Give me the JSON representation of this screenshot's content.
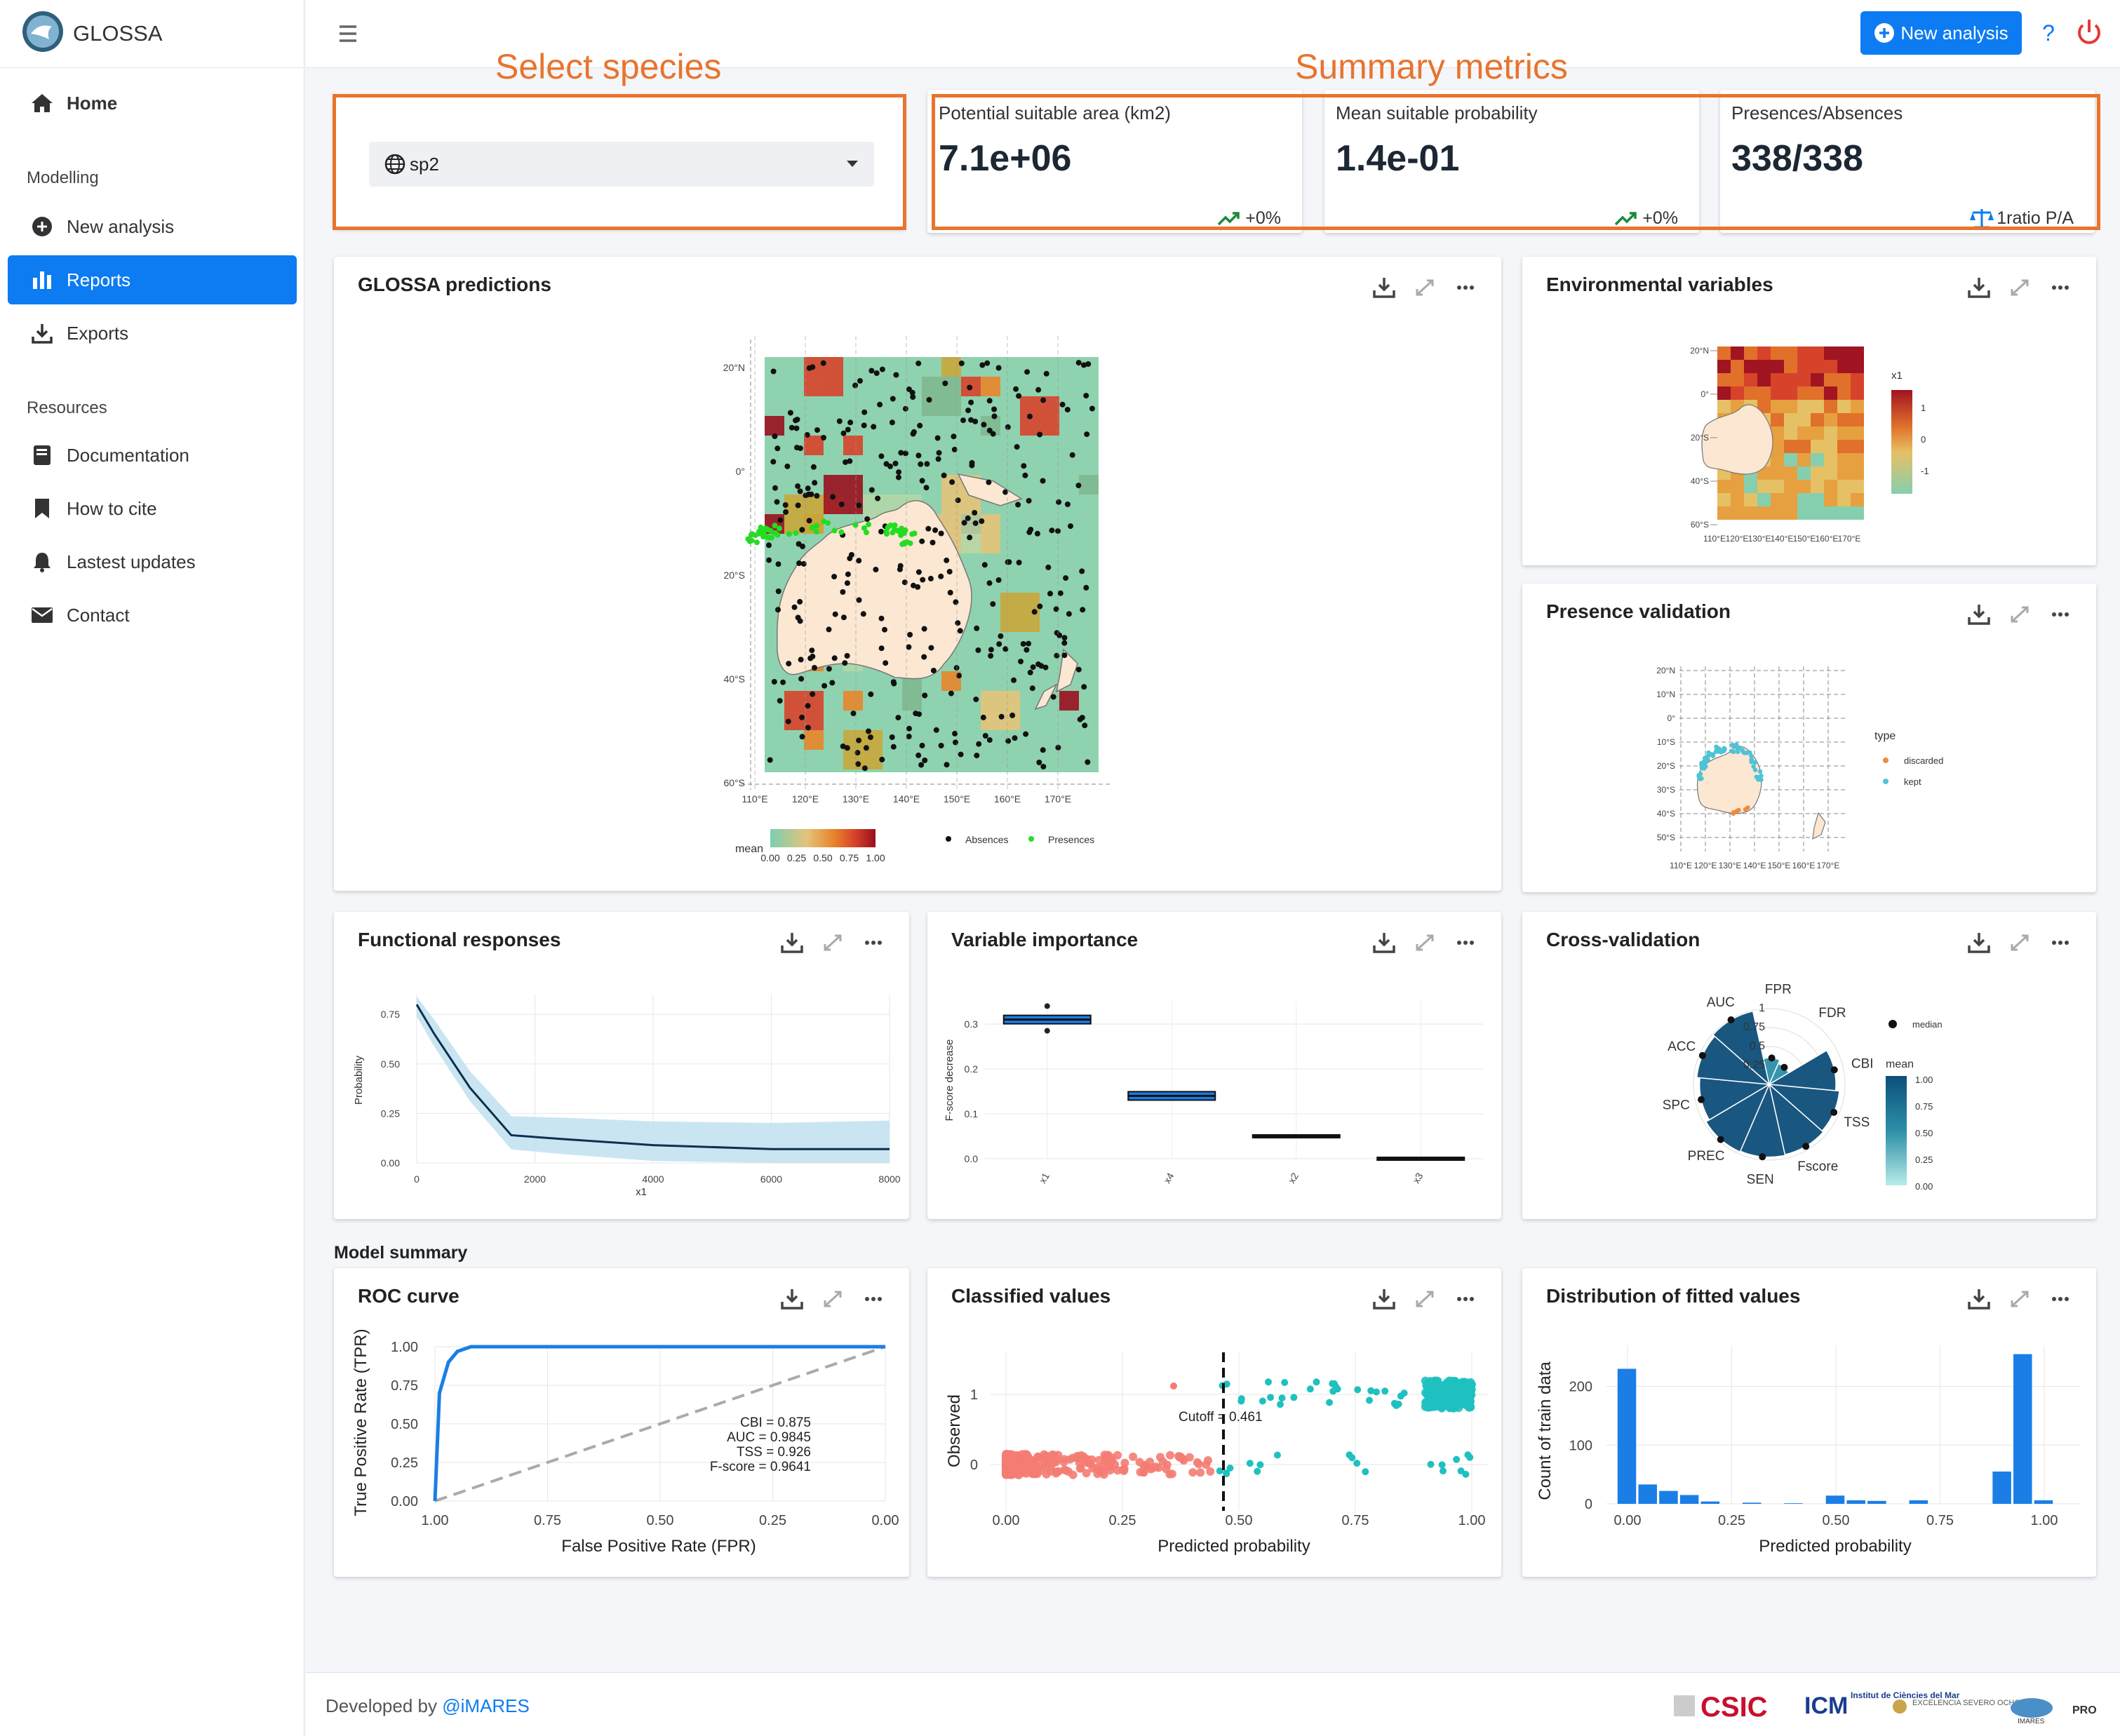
{
  "app": {
    "name": "GLOSSA"
  },
  "sidebar": {
    "home": "Home",
    "section_modelling": "Modelling",
    "new_analysis": "New analysis",
    "reports": "Reports",
    "exports": "Exports",
    "section_resources": "Resources",
    "documentation": "Documentation",
    "how_to_cite": "How to cite",
    "updates": "Lastest updates",
    "contact": "Contact"
  },
  "topbar": {
    "new_analysis": "New analysis",
    "help": "?"
  },
  "annotations": {
    "select_species": "Select species",
    "summary_metrics": "Summary metrics"
  },
  "species": {
    "selected": "sp2"
  },
  "kpis": [
    {
      "label": "Potential suitable area (km2)",
      "value": "7.1e+06",
      "trend": "+0%"
    },
    {
      "label": "Mean suitable probability",
      "value": "1.4e-01",
      "trend": "+0%"
    },
    {
      "label": "Presences/Absences",
      "value": "338/338",
      "trend": "1ratio P/A"
    }
  ],
  "cards": {
    "predictions": "GLOSSA predictions",
    "env_vars": "Environmental variables",
    "presence_validation": "Presence validation",
    "functional_responses": "Functional responses",
    "variable_importance": "Variable importance",
    "cross_validation": "Cross-validation",
    "roc": "ROC curve",
    "classified": "Classified values",
    "distribution": "Distribution of fitted values"
  },
  "model_summary_label": "Model summary",
  "maps": {
    "pred_lat": [
      "20°N",
      "0°",
      "20°S",
      "40°S",
      "60°S"
    ],
    "pred_lon": [
      "110°E",
      "120°E",
      "130°E",
      "140°E",
      "150°E",
      "160°E",
      "170°E"
    ],
    "pred_legend_title": "mean",
    "pred_legend_ticks": [
      "0.00",
      "0.25",
      "0.50",
      "0.75",
      "1.00"
    ],
    "pred_absences": "Absences",
    "pred_presences": "Presences",
    "env_lat": [
      "20°N",
      "0°",
      "20°S",
      "40°S",
      "60°S"
    ],
    "env_lon": [
      "110°E",
      "120°E",
      "130°E",
      "140°E",
      "150°E",
      "160°E",
      "170°E"
    ],
    "env_legend_title": "x1",
    "env_legend_ticks": [
      "1",
      "0",
      "-1"
    ],
    "pv_lat": [
      "20°N",
      "10°N",
      "0°",
      "10°S",
      "20°S",
      "30°S",
      "40°S",
      "50°S"
    ],
    "pv_lon": [
      "110°E",
      "120°E",
      "130°E",
      "140°E",
      "150°E",
      "160°E",
      "170°E"
    ],
    "pv_legend_title": "type",
    "pv_legend_items": [
      "discarded",
      "kept"
    ]
  },
  "colors": {
    "accent": "#0d7bf2",
    "annotation": "#e8742d",
    "ribbon": "#bfe0ee",
    "line": "#0d2f4f"
  },
  "charts": {
    "functional": {
      "ylabel": "Probability",
      "xlabel": "x1",
      "yticks": [
        "0.75",
        "0.50",
        "0.25",
        "0.00"
      ],
      "xticks": [
        "0",
        "2000",
        "4000",
        "6000",
        "8000"
      ]
    },
    "importance": {
      "ylabel": "F-score decrease",
      "yticks": [
        "0.3",
        "0.2",
        "0.1",
        "0.0"
      ],
      "categories": [
        "x1",
        "x4",
        "x2",
        "x3"
      ]
    },
    "crossval": {
      "metrics": [
        "FPR",
        "FDR",
        "CBI",
        "TSS",
        "Fscore",
        "SEN",
        "PREC",
        "SPC",
        "ACC",
        "AUC"
      ],
      "rings": [
        "1",
        "0.75",
        "0.5",
        "0.25"
      ],
      "legend_median": "median",
      "legend_mean": "mean",
      "legend_ticks": [
        "1.00",
        "0.75",
        "0.50",
        "0.25",
        "0.00"
      ]
    },
    "roc": {
      "xlabel": "False Positive Rate (FPR)",
      "ylabel": "True Positive Rate (TPR)",
      "xticks": [
        "1.00",
        "0.75",
        "0.50",
        "0.25",
        "0.00"
      ],
      "yticks": [
        "1.00",
        "0.75",
        "0.50",
        "0.25",
        "0.00"
      ],
      "stats": [
        "CBI = 0.875",
        "AUC = 0.9845",
        "TSS = 0.926",
        "F-score = 0.9641"
      ]
    },
    "classified": {
      "xlabel": "Predicted probability",
      "ylabel": "Observed",
      "xticks": [
        "0.00",
        "0.25",
        "0.50",
        "0.75",
        "1.00"
      ],
      "yticks": [
        "1",
        "0"
      ],
      "cutoff": "Cutoff = 0.461"
    },
    "distribution": {
      "xlabel": "Predicted probability",
      "ylabel": "Count of train data",
      "xticks": [
        "0.00",
        "0.25",
        "0.50",
        "0.75",
        "1.00"
      ],
      "yticks": [
        "200",
        "100",
        "0"
      ]
    }
  },
  "chart_data": [
    {
      "type": "line",
      "title": "Functional responses",
      "xlabel": "x1",
      "ylabel": "Probability",
      "x": [
        0,
        300,
        900,
        1600,
        2500,
        4000,
        6000,
        8000
      ],
      "y": [
        0.8,
        0.65,
        0.38,
        0.14,
        0.12,
        0.09,
        0.07,
        0.07
      ],
      "ylim": [
        0,
        0.85
      ],
      "xlim": [
        0,
        8000
      ]
    },
    {
      "type": "bar",
      "title": "Variable importance",
      "ylabel": "F-score decrease",
      "categories": [
        "x1",
        "x4",
        "x2",
        "x3"
      ],
      "values": [
        0.31,
        0.14,
        0.05,
        0.0
      ],
      "ylim": [
        0,
        0.35
      ]
    },
    {
      "type": "line",
      "title": "ROC curve",
      "xlabel": "False Positive Rate (FPR)",
      "ylabel": "True Positive Rate (TPR)",
      "x": [
        0.0,
        0.01,
        0.03,
        0.05,
        0.08,
        0.2,
        1.0
      ],
      "y": [
        0.0,
        0.7,
        0.9,
        0.97,
        1.0,
        1.0,
        1.0
      ]
    },
    {
      "type": "bar",
      "title": "Distribution of fitted values",
      "xlabel": "Predicted probability",
      "ylabel": "Count of train data",
      "categories": [
        "0.00",
        "0.05",
        "0.10",
        "0.15",
        "0.20",
        "0.30",
        "0.40",
        "0.50",
        "0.55",
        "0.60",
        "0.70",
        "0.90",
        "0.95",
        "1.00"
      ],
      "values": [
        230,
        33,
        22,
        15,
        4,
        2,
        1,
        14,
        6,
        5,
        6,
        55,
        255,
        6
      ],
      "ylim": [
        0,
        270
      ]
    }
  ],
  "footer": {
    "text": "Developed by ",
    "link": "@iMARES",
    "logos": [
      "CSIC",
      "ICM",
      "Institut de Ciències del Mar",
      "EXCELENCIA SEVERO OCHOA",
      "IMARES",
      "PRO"
    ]
  }
}
